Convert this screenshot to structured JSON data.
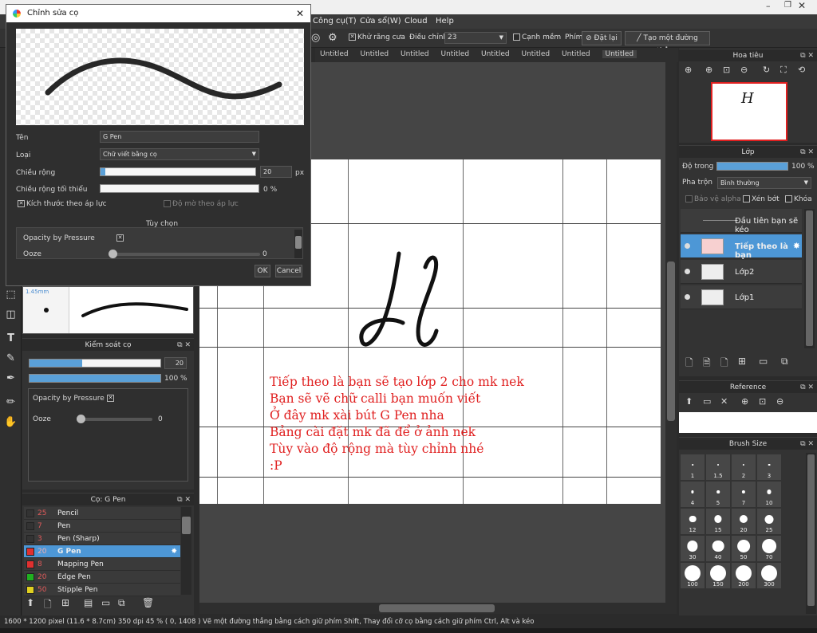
{
  "menu": {
    "tools": "Công cụ(T)",
    "window": "Cửa sổ(W)",
    "cloud": "Cloud",
    "help": "Help"
  },
  "toolbar": {
    "antialias": "Khử răng cưa",
    "adjust_label": "Điều chỉnh",
    "adjust_value": "23",
    "smooth_edge": "Cạnh mềm",
    "key_label": "Phím",
    "reset": "Đặt lại",
    "create_line": "Tạo một đường thẳng"
  },
  "tabs": [
    "Untitled",
    "Untitled",
    "Untitled",
    "Untitled",
    "Untitled",
    "Untitled",
    "Untitled",
    "Untitled"
  ],
  "dialog": {
    "title": "Chỉnh sửa cọ",
    "name_label": "Tên",
    "name_value": "G Pen",
    "type_label": "Loại",
    "type_value": "Chữ viết bằng cọ",
    "width_label": "Chiều rộng",
    "width_value": "20",
    "width_unit": "px",
    "width_level": 0.03,
    "min_width_label": "Chiều rộng tối thiểu",
    "min_width_value": "0 %",
    "min_width_level": 0.0,
    "size_pressure": "Kích thước theo áp lực",
    "opacity_pressure_toggle": "Độ mờ theo áp lực",
    "options_header": "Tùy chọn",
    "opacity_by_pressure": "Opacity by Pressure",
    "ooze": "Ooze",
    "ooze_value": "0",
    "ooze_level": 0.0,
    "ok": "OK",
    "cancel": "Cancel"
  },
  "brush_preview": {
    "size": "1.45mm"
  },
  "brush_control": {
    "title": "Kiểm soát cọ",
    "size_value": "20",
    "size_level": 0.4,
    "opacity_value": "100 %",
    "opacity_level": 1.0,
    "opacity_by_pressure": "Opacity by Pressure",
    "ooze": "Ooze",
    "ooze_value": "0",
    "ooze_level": 0.0
  },
  "brush_list": {
    "title": "Cọ: G Pen",
    "items": [
      {
        "size": "25",
        "name": "Pencil",
        "color": "#333333"
      },
      {
        "size": "7",
        "name": "Pen",
        "color": "#333333"
      },
      {
        "size": "3",
        "name": "Pen (Sharp)",
        "color": "#333333"
      },
      {
        "size": "20",
        "name": "G Pen",
        "color": "#e03030"
      },
      {
        "size": "8",
        "name": "Mapping Pen",
        "color": "#e03030"
      },
      {
        "size": "20",
        "name": "Edge Pen",
        "color": "#20b020"
      },
      {
        "size": "50",
        "name": "Stipple Pen",
        "color": "#e0d020"
      }
    ]
  },
  "navigator": {
    "title": "Hoa tiêu"
  },
  "layers": {
    "title": "Lớp",
    "opacity_label": "Độ trong",
    "opacity_value": "100 %",
    "opacity_level": 1.0,
    "blend_label": "Pha trộn",
    "blend_value": "Bình thường",
    "protect_alpha": "Bảo vệ alpha",
    "clip": "Xén bớt",
    "lock": "Khóa",
    "items": [
      {
        "name": "Đầu tiên bạn sẽ kéo"
      },
      {
        "name": "Tiếp theo là bạn"
      },
      {
        "name": "Lớp2"
      },
      {
        "name": "Lớp1"
      }
    ]
  },
  "reference": {
    "title": "Reference"
  },
  "brush_size": {
    "title": "Brush Size",
    "sizes": [
      "1",
      "1.5",
      "2",
      "3",
      "4",
      "5",
      "7",
      "10",
      "12",
      "15",
      "20",
      "25",
      "30",
      "40",
      "50",
      "70",
      "100",
      "150",
      "200",
      "300"
    ]
  },
  "canvas_notes": [
    "Tiếp theo là bạn sẽ tạo lớp 2 cho mk nek",
    "Bạn sẽ vẽ chữ calli bạn muốn viết",
    "Ở đây mk xài bút G Pen nha",
    "Bảng cài đặt mk đã để ở ảnh nek",
    "Tùy vào độ rộng mà tùy chỉnh nhé",
    ":P"
  ],
  "status": {
    "text": "1600 * 1200 pixel  (11.6 * 8.7cm)  350 dpi  45 %  ( 0, 1408 )  Vẽ một đường thẳng bằng cách giữ phím Shift, Thay đổi cỡ cọ bằng cách giữ phím Ctrl, Alt và kéo"
  }
}
